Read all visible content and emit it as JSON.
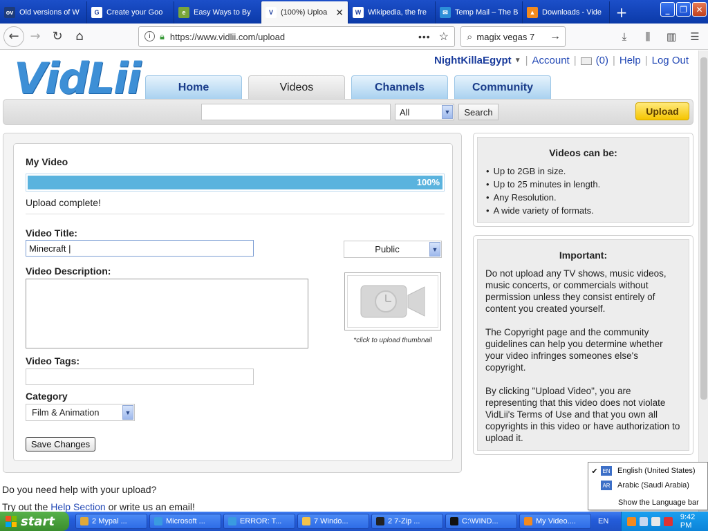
{
  "browser": {
    "tabs": [
      {
        "label": "Old versions of W",
        "favicon": "ov",
        "favcolor": "#1d3b7a",
        "active": false
      },
      {
        "label": "Create your Goo",
        "favicon": "G",
        "favcolor": "#ffffff",
        "active": false
      },
      {
        "label": "Easy Ways to By",
        "favicon": "e",
        "favcolor": "#7aa63a",
        "active": false
      },
      {
        "label": "(100%) Uploa",
        "favicon": "V",
        "favcolor": "#ffffff",
        "active": true
      },
      {
        "label": "Wikipedia, the fre",
        "favicon": "W",
        "favcolor": "#ffffff",
        "active": false
      },
      {
        "label": "Temp Mail – The B",
        "favicon": "✉",
        "favcolor": "#2d8fd8",
        "active": false
      },
      {
        "label": "Downloads - Vide",
        "favicon": "▲",
        "favcolor": "#f28a1e",
        "active": false
      }
    ],
    "new_tab": "+",
    "url": "https://www.vidlii.com/upload",
    "search_value": "magix vegas 7"
  },
  "site": {
    "logo": "VidLii",
    "user": {
      "name": "NightKillaEgypt",
      "account": "Account",
      "messages": "(0)",
      "help": "Help",
      "logout": "Log Out"
    },
    "nav": [
      {
        "label": "Home",
        "selected": false
      },
      {
        "label": "Videos",
        "selected": true
      },
      {
        "label": "Channels",
        "selected": false
      },
      {
        "label": "Community",
        "selected": false
      }
    ],
    "search": {
      "scope": "All",
      "button": "Search",
      "upload": "Upload"
    }
  },
  "form": {
    "heading": "My Video",
    "progress_percent": 100,
    "progress_label": "100%",
    "status": "Upload complete!",
    "title_label": "Video Title:",
    "title_value": "Minecraft |",
    "privacy": "Public",
    "description_label": "Video Description:",
    "thumbnail_hint": "*click to upload thumbnail",
    "tags_label": "Video Tags:",
    "category_label": "Category",
    "category_value": "Film & Animation",
    "save": "Save Changes"
  },
  "sidebar": {
    "videos_title": "Videos can be:",
    "videos_items": [
      "Up to 2GB in size.",
      "Up to 25 minutes in length.",
      "Any Resolution.",
      "A wide variety of formats."
    ],
    "important_title": "Important:",
    "important_paras": [
      "Do not upload any TV shows, music videos, music concerts, or commercials without permission unless they consist entirely of content you created yourself.",
      "The Copyright page and the community guidelines can help you determine whether your video infringes someones else's copyright.",
      "By clicking \"Upload Video\", you are representing that this video does not violate VidLii's Terms of Use and that you own all copyrights in this video or have authorization to upload it."
    ]
  },
  "help": {
    "question": "Do you need help with your upload?",
    "line_prefix": "Try out the ",
    "link": "Help Section",
    "line_suffix": " or write us an email!"
  },
  "language_popup": {
    "items": [
      {
        "code": "EN",
        "label": "English (United States)",
        "checked": true
      },
      {
        "code": "AR",
        "label": "Arabic (Saudi Arabia)",
        "checked": false
      }
    ],
    "show_bar": "Show the Language bar"
  },
  "taskbar": {
    "start": "start",
    "tasks": [
      "2 Mypal ...",
      "Microsoft ...",
      "ERROR: T...",
      "7 Windo...",
      "2 7-Zip ...",
      "C:\\WIND...",
      "My Video...."
    ],
    "lang": "EN",
    "clock": "9:42 PM"
  }
}
